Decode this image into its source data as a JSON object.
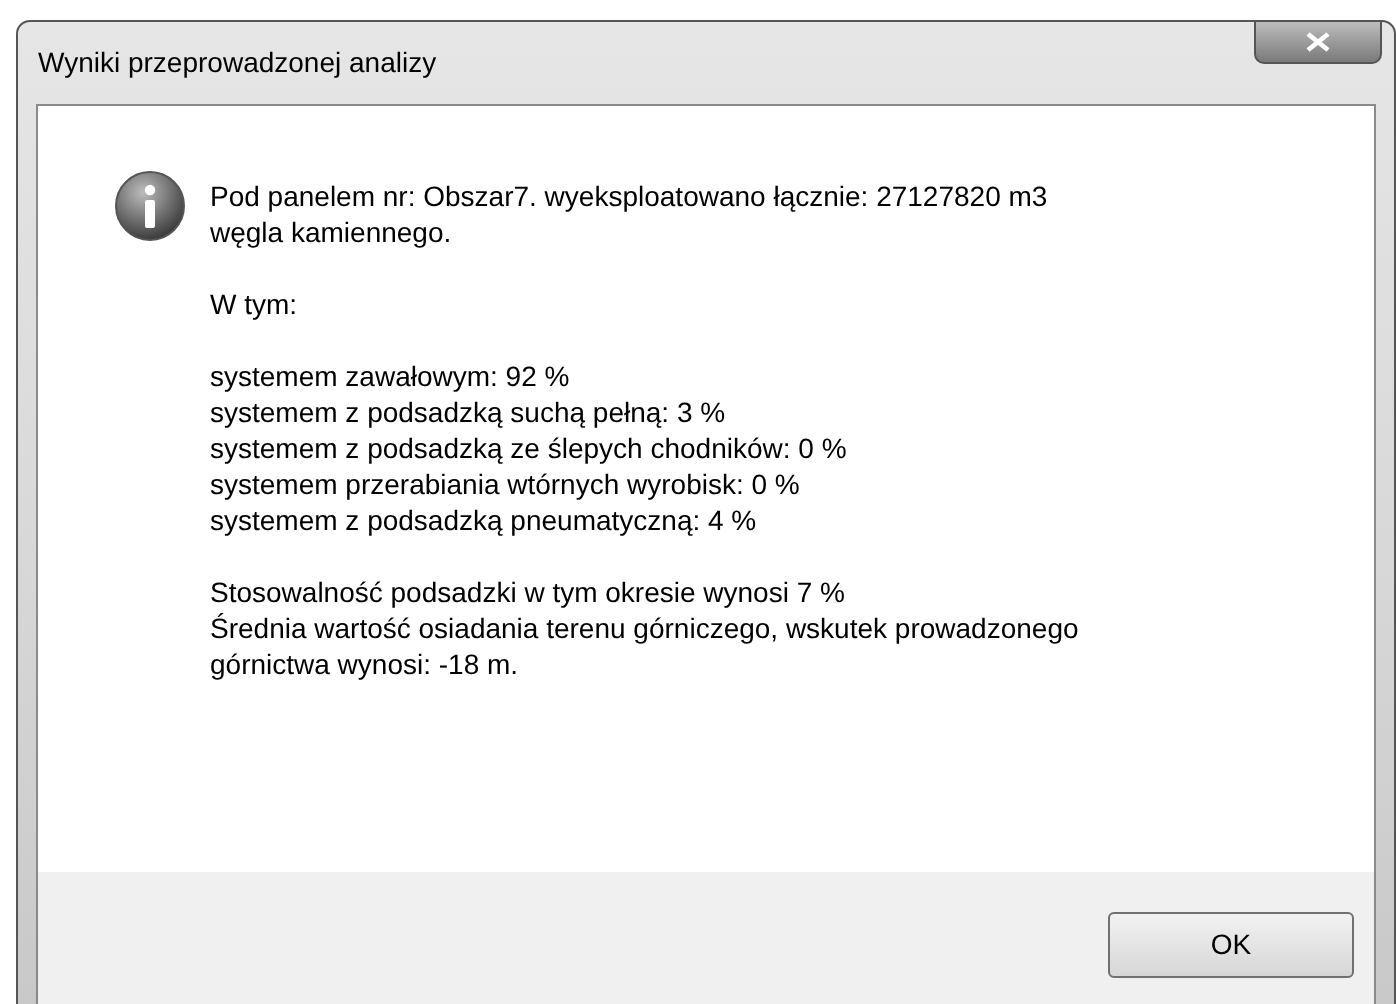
{
  "window": {
    "title": "Wyniki przeprowadzonej analizy"
  },
  "message": {
    "paragraphs": [
      [
        "Pod panelem nr: Obszar7. wyeksploatowano łącznie: 27127820 m3",
        "węgla kamiennego."
      ],
      [
        "W tym:"
      ],
      [
        "systemem zawałowym: 92 %",
        "systemem z podsadzką suchą pełną: 3 %",
        "systemem z podsadzką ze ślepych chodników: 0 %",
        "systemem przerabiania wtórnych wyrobisk: 0 %",
        "systemem z podsadzką pneumatyczną: 4 %"
      ],
      [
        "Stosowalność podsadzki w tym okresie wynosi 7 %",
        "Średnia wartość osiadania terenu górniczego, wskutek prowadzonego",
        "górnictwa wynosi: -18 m."
      ]
    ]
  },
  "buttons": [
    "OK"
  ]
}
